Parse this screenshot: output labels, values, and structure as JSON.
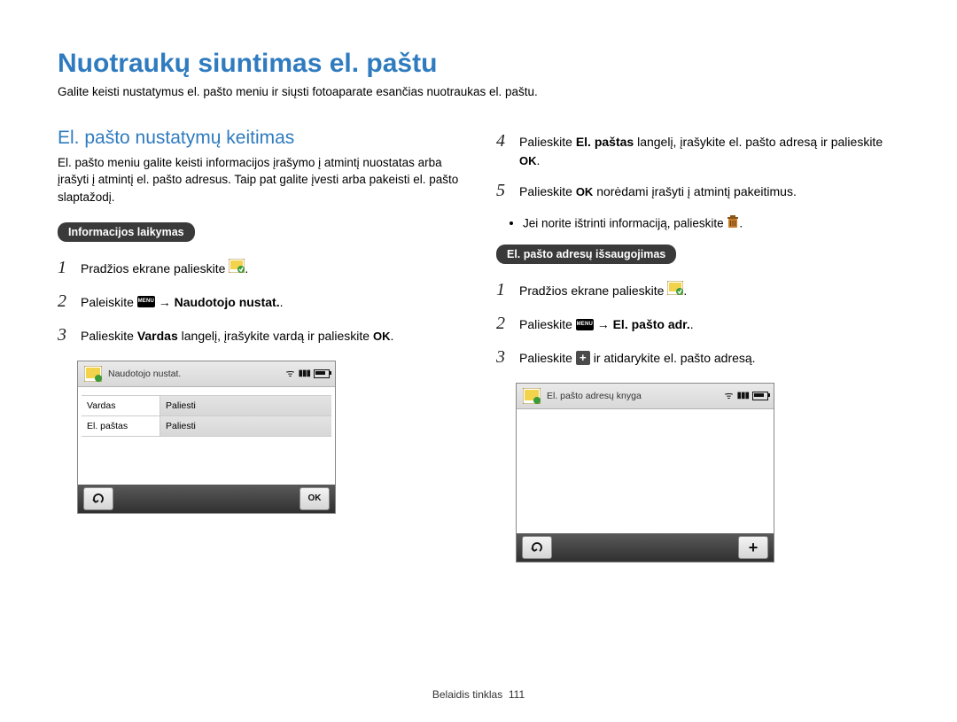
{
  "title": "Nuotraukų siuntimas el. paštu",
  "subtitle": "Galite keisti nustatymus el. pašto meniu ir siųsti fotoaparate esančias nuotraukas el. paštu.",
  "left": {
    "section_title": "El. pašto nustatymų keitimas",
    "section_desc": "El. pašto meniu galite keisti informacijos įrašymo į atmintį nuostatas arba įrašyti į atmintį el. pašto adresus. Taip pat galite įvesti arba pakeisti el. pašto slaptažodį.",
    "pill": "Informacijos laikymas",
    "steps": {
      "s1": "Pradžios ekrane palieskite",
      "s2_pre": "Paleiskite",
      "s2_post": "Naudotojo nustat.",
      "s3_a": "Palieskite ",
      "s3_b": "Vardas",
      "s3_c": " langelį, įrašykite vardą ir palieskite ",
      "s3_ok": "OK"
    },
    "device": {
      "header": "Naudotojo nustat.",
      "row1_k": "Vardas",
      "row1_v": "Paliesti",
      "row2_k": "El. paštas",
      "row2_v": "Paliesti",
      "foot_ok": "OK"
    }
  },
  "right": {
    "steps_top": {
      "s4_a": "Palieskite ",
      "s4_b": "El. paštas",
      "s4_c": " langelį, įrašykite el. pašto adresą ir palieskite ",
      "s4_ok": "OK",
      "s5_a": "Palieskite ",
      "s5_ok": "OK",
      "s5_b": " norėdami įrašyti į atmintį pakeitimus.",
      "sub1": "Jei norite ištrinti informaciją, palieskite "
    },
    "pill": "El. pašto adresų išsaugojimas",
    "steps_bot": {
      "s1": "Pradžios ekrane palieskite",
      "s2_pre": "Palieskite",
      "s2_post": "El. pašto adr.",
      "s3_a": "Palieskite ",
      "s3_b": " ir atidarykite el. pašto adresą."
    },
    "device": {
      "header": "El. pašto adresų knyga"
    }
  },
  "footer_label": "Belaidis tinklas",
  "footer_page": "111",
  "glyphs": {
    "menu": "MENU",
    "arrow": "→",
    "back": "↶",
    "plus": "+",
    "ok_period": "."
  }
}
